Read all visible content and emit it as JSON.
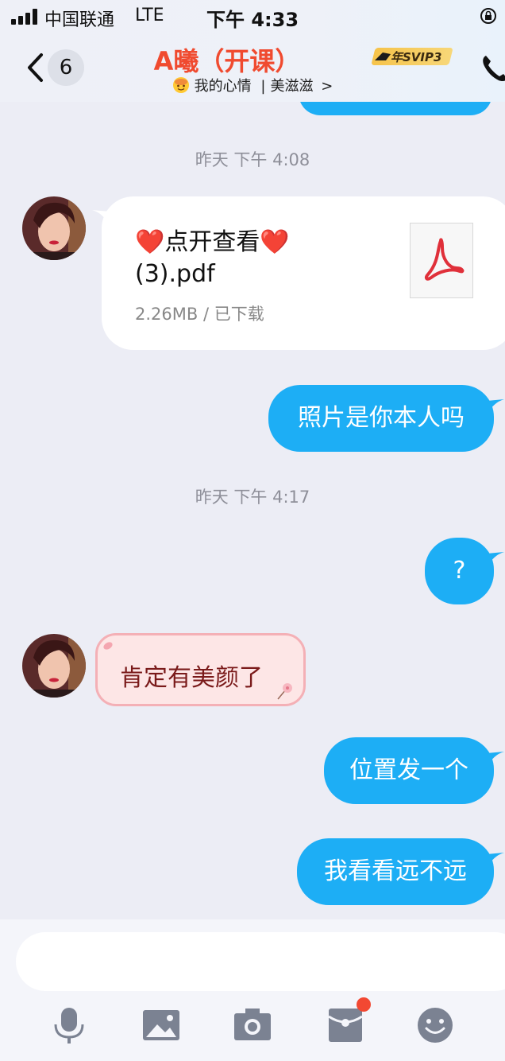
{
  "status_bar": {
    "carrier": "中国联通",
    "network": "LTE",
    "time": "下午 4:33"
  },
  "header": {
    "back_count": "6",
    "contact_name": "A曦（开课）",
    "svip_label": "年SVIP3",
    "mood_label": "我的心情",
    "mood_value": "美滋滋",
    "separator": "|",
    "chevron": ">"
  },
  "messages": {
    "time_1": "昨天 下午 4:08",
    "file": {
      "name_prefix": "❤️",
      "name_text": "点开查看",
      "name_suffix": "❤️",
      "name_line2": "(3).pdf",
      "size": "2.26MB",
      "status": "已下载",
      "sep": " / "
    },
    "out_1": "照片是你本人吗",
    "time_2": "昨天 下午 4:17",
    "out_2": "?",
    "in_1": "肯定有美颜了",
    "out_3": "位置发一个",
    "out_4": "我看看远不远"
  },
  "colors": {
    "outgoing_bubble": "#1daef5",
    "title": "#f04a2f",
    "notification_dot": "#f24832"
  },
  "icons": {
    "toolbar": [
      "microphone-icon",
      "image-icon",
      "camera-icon",
      "red-packet-icon",
      "emoji-icon"
    ]
  }
}
